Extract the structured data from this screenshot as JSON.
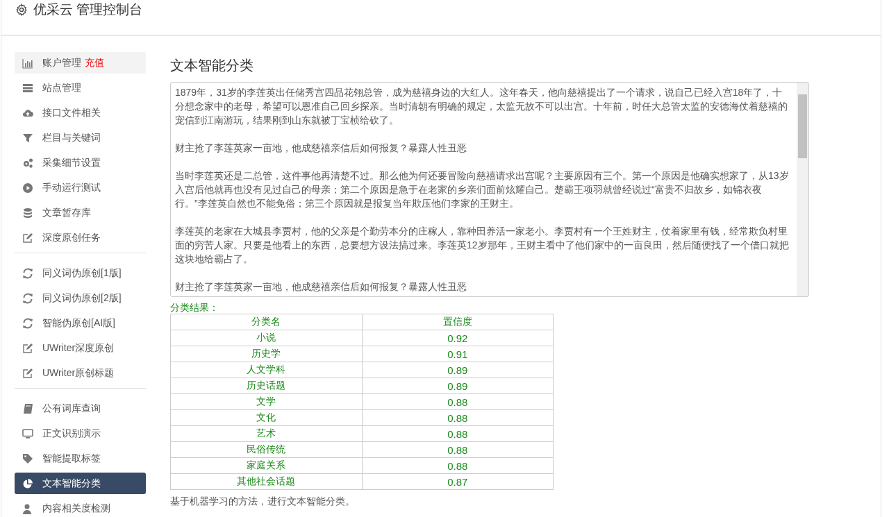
{
  "header": {
    "title": "优采云 管理控制台"
  },
  "sidebar": {
    "groups": [
      [
        {
          "label": "账户管理",
          "badge": "充值",
          "highlighted": true,
          "selected": false
        },
        {
          "label": "站点管理",
          "highlighted": false,
          "selected": false
        },
        {
          "label": "接口文件相关",
          "highlighted": false,
          "selected": false
        },
        {
          "label": "栏目与关键词",
          "highlighted": false,
          "selected": false
        },
        {
          "label": "采集细节设置",
          "highlighted": false,
          "selected": false
        },
        {
          "label": "手动运行测试",
          "highlighted": false,
          "selected": false
        },
        {
          "label": "文章暂存库",
          "highlighted": false,
          "selected": false
        },
        {
          "label": "深度原创任务",
          "highlighted": false,
          "selected": false
        }
      ],
      [
        {
          "label": "同义词伪原创[1版]",
          "highlighted": false,
          "selected": false
        },
        {
          "label": "同义词伪原创[2版]",
          "highlighted": false,
          "selected": false
        },
        {
          "label": "智能伪原创[AI版]",
          "highlighted": false,
          "selected": false
        },
        {
          "label": "UWriter深度原创",
          "highlighted": false,
          "selected": false
        },
        {
          "label": "UWriter原创标题",
          "highlighted": false,
          "selected": false
        }
      ],
      [
        {
          "label": "公有词库查询",
          "highlighted": false,
          "selected": false
        },
        {
          "label": "正文识别演示",
          "highlighted": false,
          "selected": false
        },
        {
          "label": "智能提取标签",
          "highlighted": false,
          "selected": false
        },
        {
          "label": "文本智能分类",
          "highlighted": false,
          "selected": true
        },
        {
          "label": "内容相关度检测",
          "highlighted": false,
          "selected": false
        }
      ]
    ]
  },
  "main": {
    "heading": "文本智能分类",
    "text_area": {
      "paragraphs": [
        "1879年，31岁的李莲英出任储秀宫四品花翎总管，成为慈禧身边的大红人。这年春天，他向慈禧提出了一个请求，说自己已经入宫18年了，十分想念家中的老母，希望可以恩准自己回乡探亲。当时清朝有明确的规定，太监无故不可以出宫。十年前，时任大总管太监的安德海仗着慈禧的宠信到江南游玩，结果刚到山东就被丁宝桢给砍了。",
        "财主抢了李莲英家一亩地，他成慈禧亲信后如何报复？暴露人性丑恶",
        "当时李莲英还是二总管，这件事他再清楚不过。那么他为何还要冒险向慈禧请求出宫呢？主要原因有三个。第一个原因是他确实想家了，从13岁入宫后他就再也没有见过自己的母亲；第二个原因是急于在老家的乡亲们面前炫耀自己。楚霸王项羽就曾经说过“富贵不归故乡，如锦衣夜行。”李莲英自然也不能免俗；第三个原因就是报复当年欺压他们李家的王财主。",
        "李莲英的老家在大城县李贾村，他的父亲是个勤劳本分的庄稼人，靠种田养活一家老小。李贾村有一个王姓财主，仗着家里有钱，经常欺负村里面的穷苦人家。只要是他看上的东西，总要想方设法搞过来。李莲英12岁那年，王财主看中了他们家中的一亩良田，然后随便找了一个借口就把这块地给霸占了。",
        "财主抢了李莲英家一亩地，他成慈禧亲信后如何报复？暴露人性丑恶"
      ]
    },
    "result_label": "分类结果：",
    "table": {
      "columns": [
        "分类名",
        "置信度"
      ],
      "rows": [
        [
          "小说",
          "0.92"
        ],
        [
          "历史学",
          "0.91"
        ],
        [
          "人文学科",
          "0.89"
        ],
        [
          "历史话题",
          "0.89"
        ],
        [
          "文学",
          "0.88"
        ],
        [
          "文化",
          "0.88"
        ],
        [
          "艺术",
          "0.88"
        ],
        [
          "民俗传统",
          "0.88"
        ],
        [
          "家庭关系",
          "0.88"
        ],
        [
          "其他社会话题",
          "0.87"
        ]
      ]
    },
    "note": "基于机器学习的方法，进行文本智能分类。"
  }
}
